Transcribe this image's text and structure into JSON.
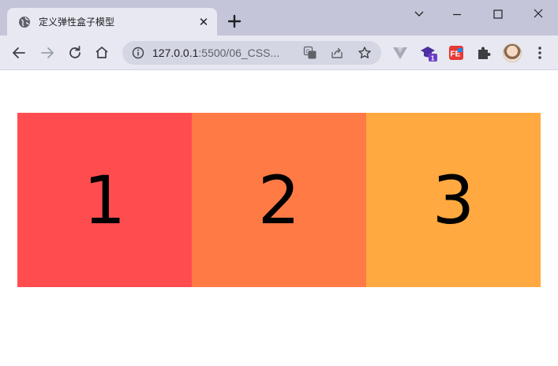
{
  "browser": {
    "tab": {
      "title": "定义弹性盒子模型",
      "close_glyph": "✕"
    },
    "address": {
      "host": "127.0.0.1",
      "rest": ":5500/06_CSS..."
    },
    "extensions": [
      {
        "name": "vue-devtools-icon"
      },
      {
        "name": "graduation-cap-icon",
        "badge": "1"
      },
      {
        "name": "fe-helper-icon",
        "label": "FE"
      },
      {
        "name": "puzzle-icon"
      }
    ]
  },
  "page": {
    "items": [
      {
        "label": "1",
        "color": "#ff4d4f"
      },
      {
        "label": "2",
        "color": "#ff7a45"
      },
      {
        "label": "3",
        "color": "#ffa940"
      }
    ]
  }
}
